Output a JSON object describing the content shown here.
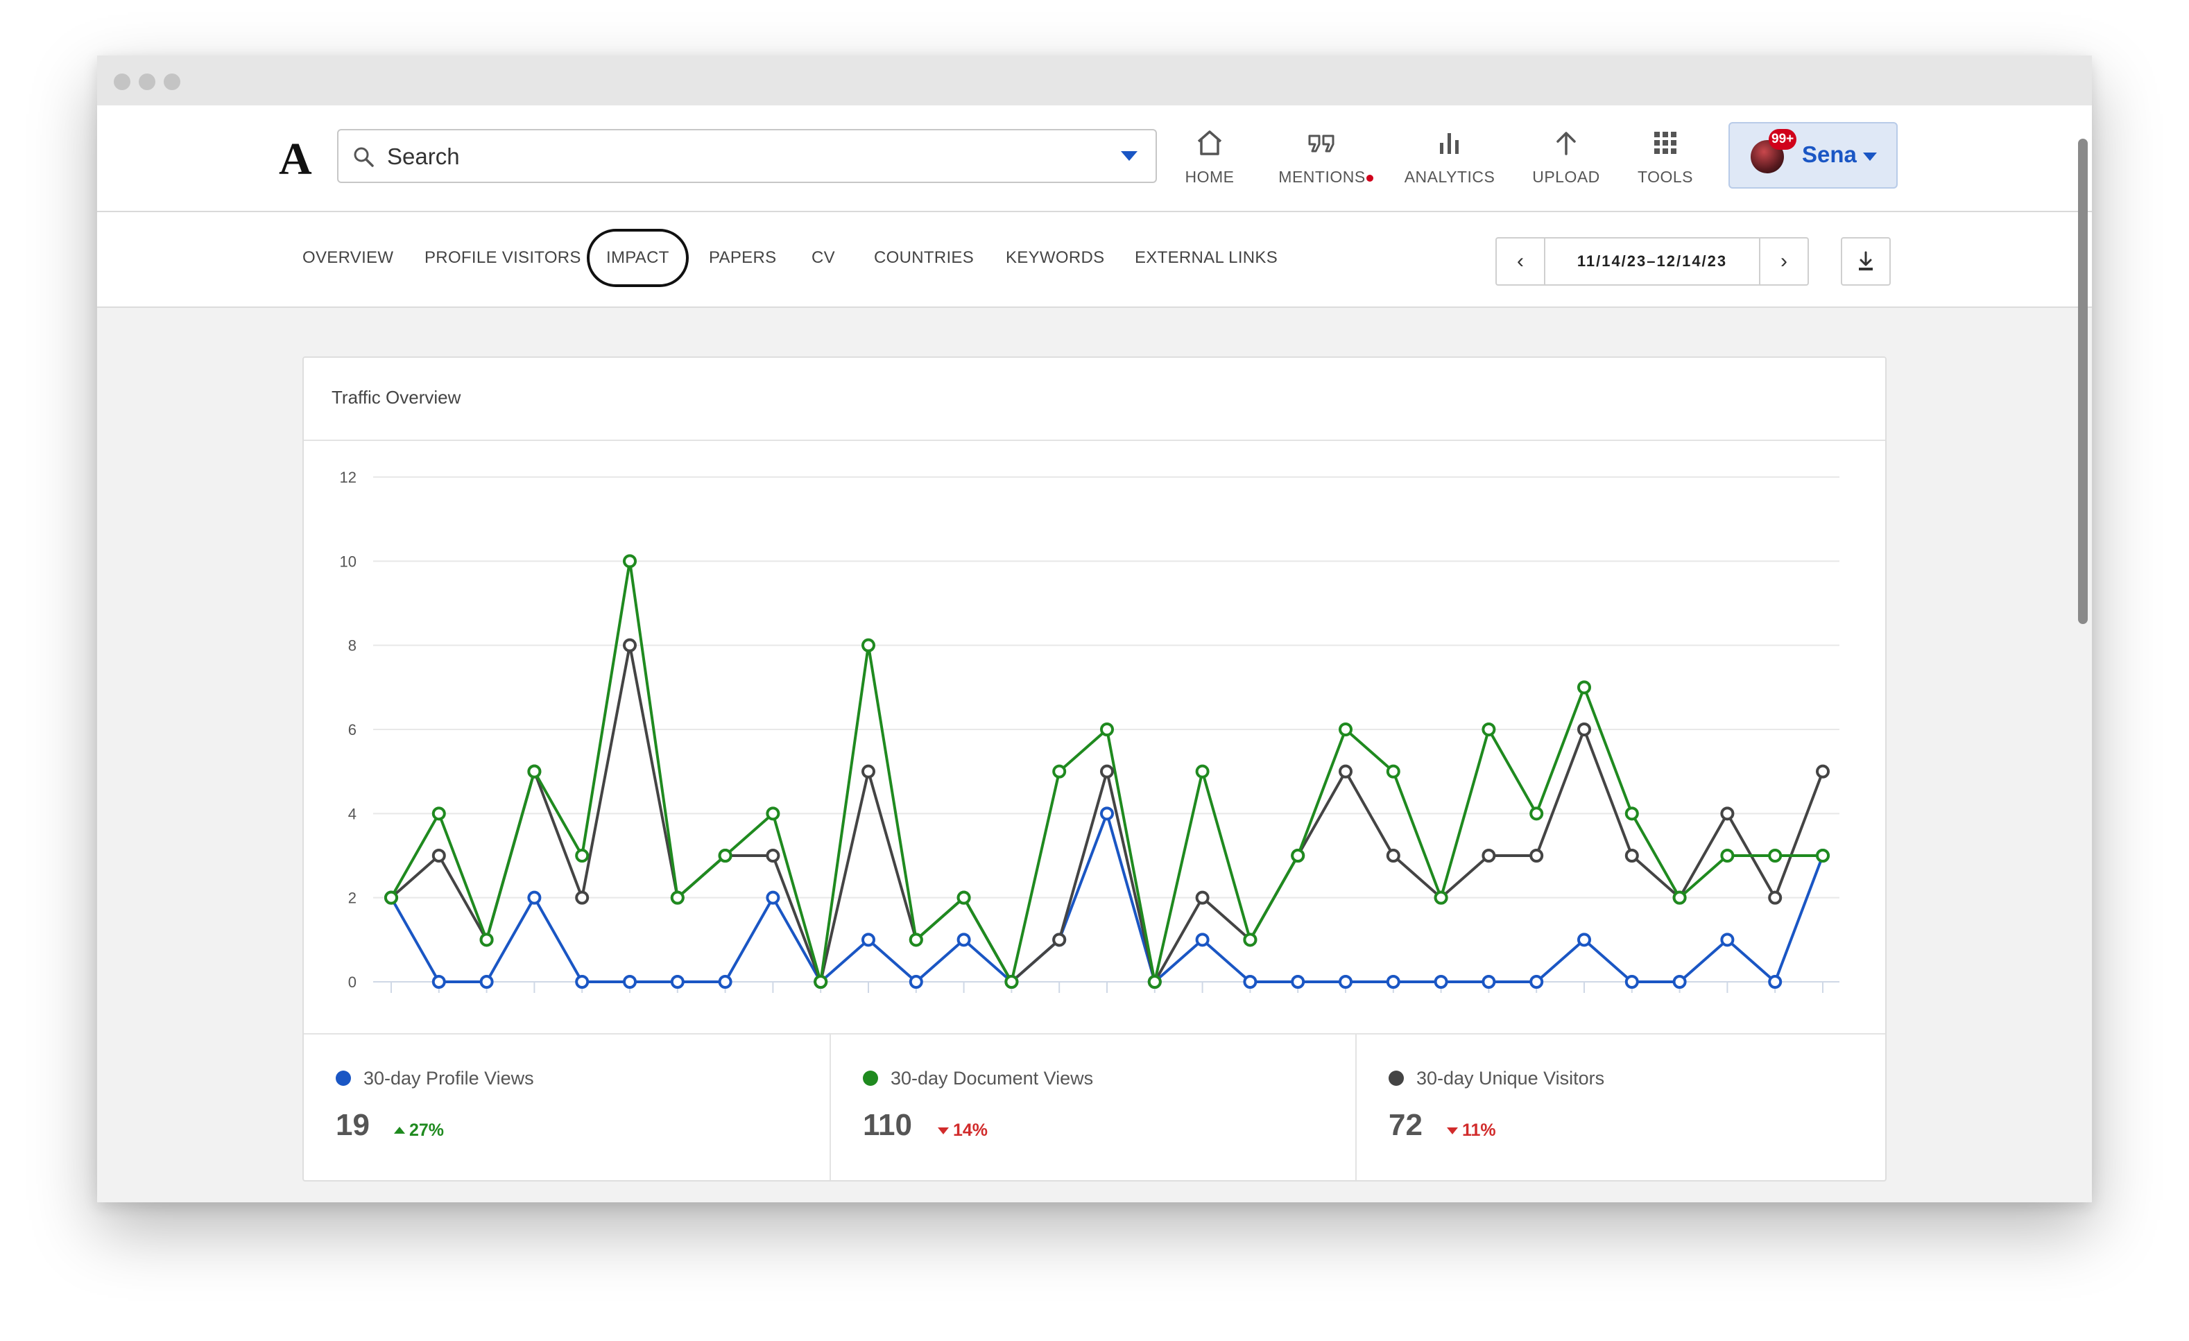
{
  "topnav": {
    "logo": "A",
    "search": {
      "placeholder": "Search"
    },
    "items": [
      {
        "label": "HOME",
        "icon": "home-icon"
      },
      {
        "label": "MENTIONS",
        "icon": "quote-icon"
      },
      {
        "label": "ANALYTICS",
        "icon": "bar-chart-icon"
      },
      {
        "label": "UPLOAD",
        "icon": "upload-arrow-icon"
      },
      {
        "label": "TOOLS",
        "icon": "grid-icon"
      }
    ],
    "user": {
      "name": "Sena",
      "badge": "99+"
    }
  },
  "subnav": {
    "tabs": [
      {
        "label": "OVERVIEW"
      },
      {
        "label": "PROFILE VISITORS"
      },
      {
        "label": "IMPACT"
      },
      {
        "label": "PAPERS"
      },
      {
        "label": "CV"
      },
      {
        "label": "COUNTRIES"
      },
      {
        "label": "KEYWORDS"
      },
      {
        "label": "EXTERNAL LINKS"
      }
    ],
    "active_tab": "IMPACT",
    "date_range": "11/14/23–12/14/23"
  },
  "card": {
    "title": "Traffic Overview"
  },
  "colors": {
    "profile_views": "#1a56c4",
    "document_views": "#1f8a1f",
    "unique_visitors": "#444444",
    "up": "#1f8a1f",
    "down": "#d12b2b",
    "accent": "#1a56c4"
  },
  "chart_data": {
    "type": "line",
    "title": "Traffic Overview",
    "xlabel": "",
    "ylabel": "",
    "ylim": [
      0,
      12
    ],
    "yticks": [
      "0",
      "2",
      "4",
      "6",
      "8",
      "10",
      "12"
    ],
    "grid": true,
    "series": [
      {
        "name": "30-day Profile Views",
        "color": "#1a56c4",
        "values": [
          2,
          0,
          0,
          2,
          0,
          0,
          0,
          0,
          2,
          0,
          1,
          0,
          1,
          0,
          1,
          4,
          0,
          1,
          0,
          0,
          0,
          0,
          0,
          0,
          0,
          1,
          0,
          0,
          1,
          0,
          3
        ]
      },
      {
        "name": "30-day Document Views",
        "color": "#1f8a1f",
        "values": [
          2,
          4,
          1,
          5,
          3,
          10,
          2,
          3,
          4,
          0,
          8,
          1,
          2,
          0,
          5,
          6,
          0,
          5,
          1,
          3,
          6,
          5,
          2,
          6,
          4,
          7,
          4,
          2,
          3,
          3,
          3
        ]
      },
      {
        "name": "30-day Unique Visitors",
        "color": "#444444",
        "values": [
          2,
          3,
          1,
          5,
          2,
          8,
          2,
          3,
          3,
          0,
          5,
          1,
          2,
          0,
          1,
          5,
          0,
          2,
          1,
          3,
          5,
          3,
          2,
          3,
          3,
          6,
          3,
          2,
          4,
          2,
          5
        ]
      }
    ]
  },
  "stats": [
    {
      "label": "30-day Profile Views",
      "value": "19",
      "change": "27%",
      "direction": "up"
    },
    {
      "label": "30-day Document Views",
      "value": "110",
      "change": "14%",
      "direction": "down"
    },
    {
      "label": "30-day Unique Visitors",
      "value": "72",
      "change": "11%",
      "direction": "down"
    }
  ]
}
